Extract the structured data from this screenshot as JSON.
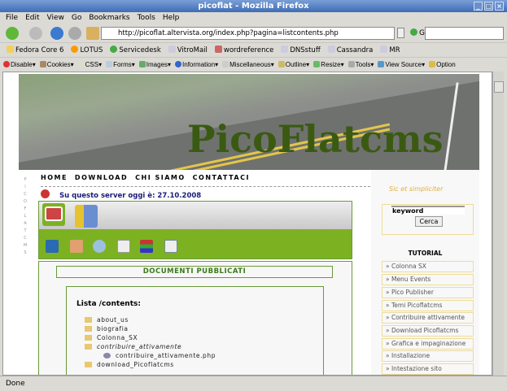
{
  "window": {
    "title": "picoflat - Mozilla Firefox"
  },
  "menu": [
    "File",
    "Edit",
    "View",
    "Go",
    "Bookmarks",
    "Tools",
    "Help"
  ],
  "nav": {
    "url": "http://picoflat.altervista.org/index.php?pagina=listcontents.php",
    "go": "Go"
  },
  "bookmarks": [
    "Fedora Core 6",
    "LOTUS",
    "Servicedesk",
    "VitroMail",
    "wordreference",
    "DNSstuff",
    "Cassandra",
    "MR"
  ],
  "devbar": [
    "Disable",
    "Cookies",
    "CSS",
    "Forms",
    "Images",
    "Information",
    "Miscellaneous",
    "Outline",
    "Resize",
    "Tools",
    "View Source",
    "Option"
  ],
  "site": {
    "brand": "PicoFlatcms",
    "vertical": [
      "P",
      "I",
      "C",
      "O",
      "F",
      "L",
      "A",
      "T",
      "C",
      "M",
      "S"
    ],
    "topnav": [
      "HOME",
      "DOWNLOAD",
      "CHI SIAMO",
      "CONTATTACI"
    ],
    "date": "Su questo server oggi è: 27.10.2008",
    "doc_title": "DOCUMENTI PUBBLICATI",
    "list_title": "Lista /contents:",
    "list": [
      {
        "name": "about_us",
        "type": "folder"
      },
      {
        "name": "biografia",
        "type": "folder"
      },
      {
        "name": "Colonna_SX",
        "type": "folder"
      },
      {
        "name": "contribuire_attivamente",
        "type": "folder-open"
      },
      {
        "name": "contribuire_attivamente.php",
        "type": "file"
      },
      {
        "name": "download_Picoflatcms",
        "type": "folder"
      }
    ],
    "motto": "Sic et simpliciter",
    "search": {
      "value": "keyword",
      "button": "Cerca"
    },
    "tutorial_title": "TUTORIAL",
    "tutorials": [
      "» Colonna SX",
      "» Menu Events",
      "» Pico Publisher",
      "» Temi Picoflatcms",
      "» Contribuire attivamente",
      "» Download Picoflatcms",
      "» Grafica e impaginazione",
      "» Installazione",
      "» Intestazione sito"
    ]
  },
  "status": "Done"
}
